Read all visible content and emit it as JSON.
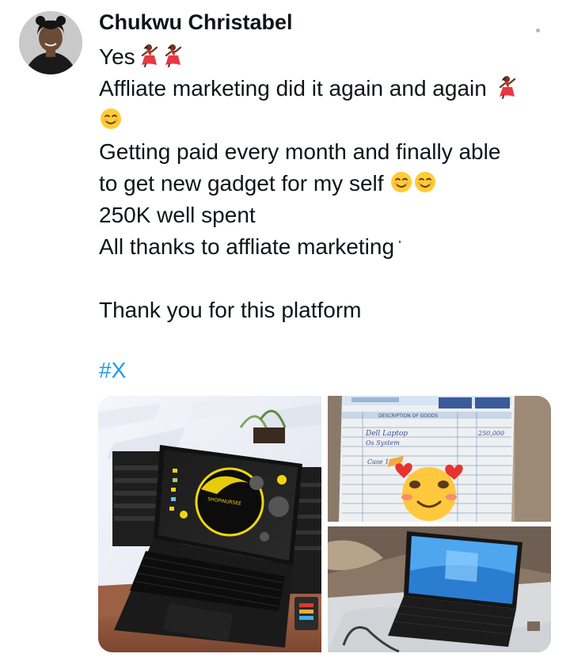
{
  "tweet": {
    "author_name": "Chukwu Christabel",
    "lines": [
      "Yes",
      "Affliate marketing did it again and again",
      "Getting paid every month and finally able",
      "to get new gadget for my self",
      "250K well spent",
      "All thanks to affliate marketing",
      "Thank you for this platform"
    ],
    "hashtag": "#X"
  },
  "media": {
    "screen_brand": "SHOPINURSEE",
    "receipt_header": "DESCRIPTION OF GOODS",
    "receipt_item_1": "Dell Laptop",
    "receipt_item_2": "Os System",
    "receipt_item_3": "Case 13",
    "receipt_amount": "250,000"
  },
  "icons": {
    "dancer": "woman-dancing-emoji",
    "smile": "smiling-face-emoji",
    "hearts": "smiling-face-with-hearts-emoji"
  },
  "colors": {
    "hashtag": "#1d9bf0",
    "text": "#0f1419"
  }
}
